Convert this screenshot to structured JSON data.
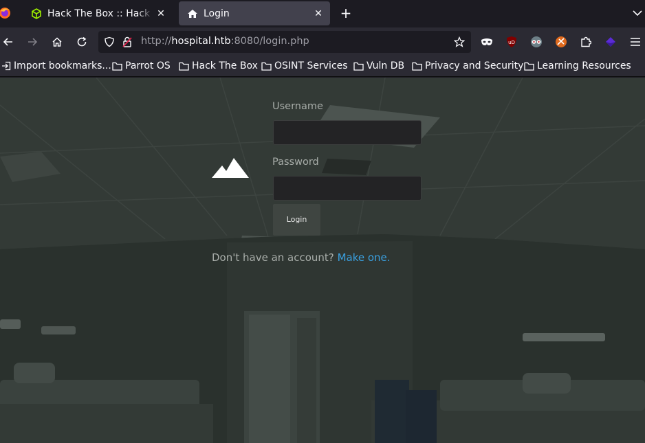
{
  "browser": {
    "tabs": [
      {
        "title": "Hack The Box :: Hack The Box"
      },
      {
        "title": "Login"
      }
    ],
    "address": {
      "prefix": "http://",
      "host": "hospital.htb",
      "rest": ":8080/login.php"
    },
    "bookmarks": [
      {
        "label": "Import bookmarks...",
        "icon": "import-icon"
      },
      {
        "label": "Parrot OS",
        "icon": "folder-icon"
      },
      {
        "label": "Hack The Box",
        "icon": "folder-icon"
      },
      {
        "label": "OSINT Services",
        "icon": "folder-icon"
      },
      {
        "label": "Vuln DB",
        "icon": "folder-icon"
      },
      {
        "label": "Privacy and Security",
        "icon": "folder-icon"
      },
      {
        "label": "Learning Resources",
        "icon": "folder-icon"
      }
    ]
  },
  "login": {
    "username_label": "Username",
    "username_value": "",
    "password_label": "Password",
    "password_value": "",
    "button_label": "Login",
    "signup_prompt": "Don't have an account?",
    "signup_link": "Make one."
  },
  "colors": {
    "link": "#3aa0e0",
    "tab_active": "#42414d",
    "toolbar": "#2b2a33"
  }
}
